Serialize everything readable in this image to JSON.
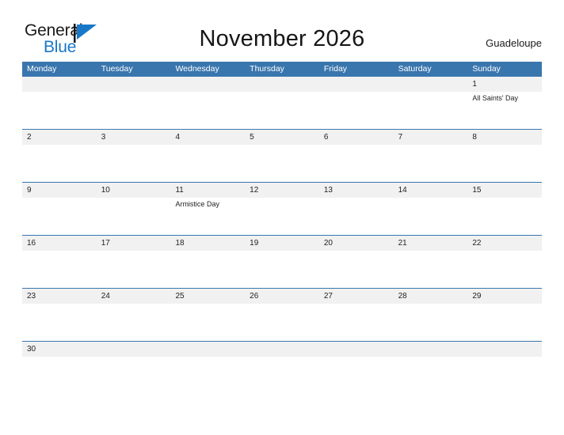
{
  "brand": {
    "name_part1": "General",
    "name_part2": "Blue",
    "flag_icon": "flag-triangle-icon",
    "accent_color": "#1878c8",
    "text_color": "#1a1a1a"
  },
  "header": {
    "title": "November 2026",
    "region": "Guadeloupe"
  },
  "colors": {
    "header_bar": "#3a76ae",
    "day_band": "#f1f1f1",
    "row_rule": "#3a76ae",
    "cell_background": "#ffffff",
    "text": "#1f1f1f"
  },
  "calendar": {
    "month": "November",
    "year": "2026",
    "weekdays": [
      "Monday",
      "Tuesday",
      "Wednesday",
      "Thursday",
      "Friday",
      "Saturday",
      "Sunday"
    ],
    "weeks": [
      {
        "days": [
          {
            "num": "",
            "event": ""
          },
          {
            "num": "",
            "event": ""
          },
          {
            "num": "",
            "event": ""
          },
          {
            "num": "",
            "event": ""
          },
          {
            "num": "",
            "event": ""
          },
          {
            "num": "",
            "event": ""
          },
          {
            "num": "1",
            "event": "All Saints' Day"
          }
        ]
      },
      {
        "days": [
          {
            "num": "2",
            "event": ""
          },
          {
            "num": "3",
            "event": ""
          },
          {
            "num": "4",
            "event": ""
          },
          {
            "num": "5",
            "event": ""
          },
          {
            "num": "6",
            "event": ""
          },
          {
            "num": "7",
            "event": ""
          },
          {
            "num": "8",
            "event": ""
          }
        ]
      },
      {
        "days": [
          {
            "num": "9",
            "event": ""
          },
          {
            "num": "10",
            "event": ""
          },
          {
            "num": "11",
            "event": "Armistice Day"
          },
          {
            "num": "12",
            "event": ""
          },
          {
            "num": "13",
            "event": ""
          },
          {
            "num": "14",
            "event": ""
          },
          {
            "num": "15",
            "event": ""
          }
        ]
      },
      {
        "days": [
          {
            "num": "16",
            "event": ""
          },
          {
            "num": "17",
            "event": ""
          },
          {
            "num": "18",
            "event": ""
          },
          {
            "num": "19",
            "event": ""
          },
          {
            "num": "20",
            "event": ""
          },
          {
            "num": "21",
            "event": ""
          },
          {
            "num": "22",
            "event": ""
          }
        ]
      },
      {
        "days": [
          {
            "num": "23",
            "event": ""
          },
          {
            "num": "24",
            "event": ""
          },
          {
            "num": "25",
            "event": ""
          },
          {
            "num": "26",
            "event": ""
          },
          {
            "num": "27",
            "event": ""
          },
          {
            "num": "28",
            "event": ""
          },
          {
            "num": "29",
            "event": ""
          }
        ]
      },
      {
        "days": [
          {
            "num": "30",
            "event": ""
          },
          {
            "num": "",
            "event": ""
          },
          {
            "num": "",
            "event": ""
          },
          {
            "num": "",
            "event": ""
          },
          {
            "num": "",
            "event": ""
          },
          {
            "num": "",
            "event": ""
          },
          {
            "num": "",
            "event": ""
          }
        ]
      }
    ]
  }
}
